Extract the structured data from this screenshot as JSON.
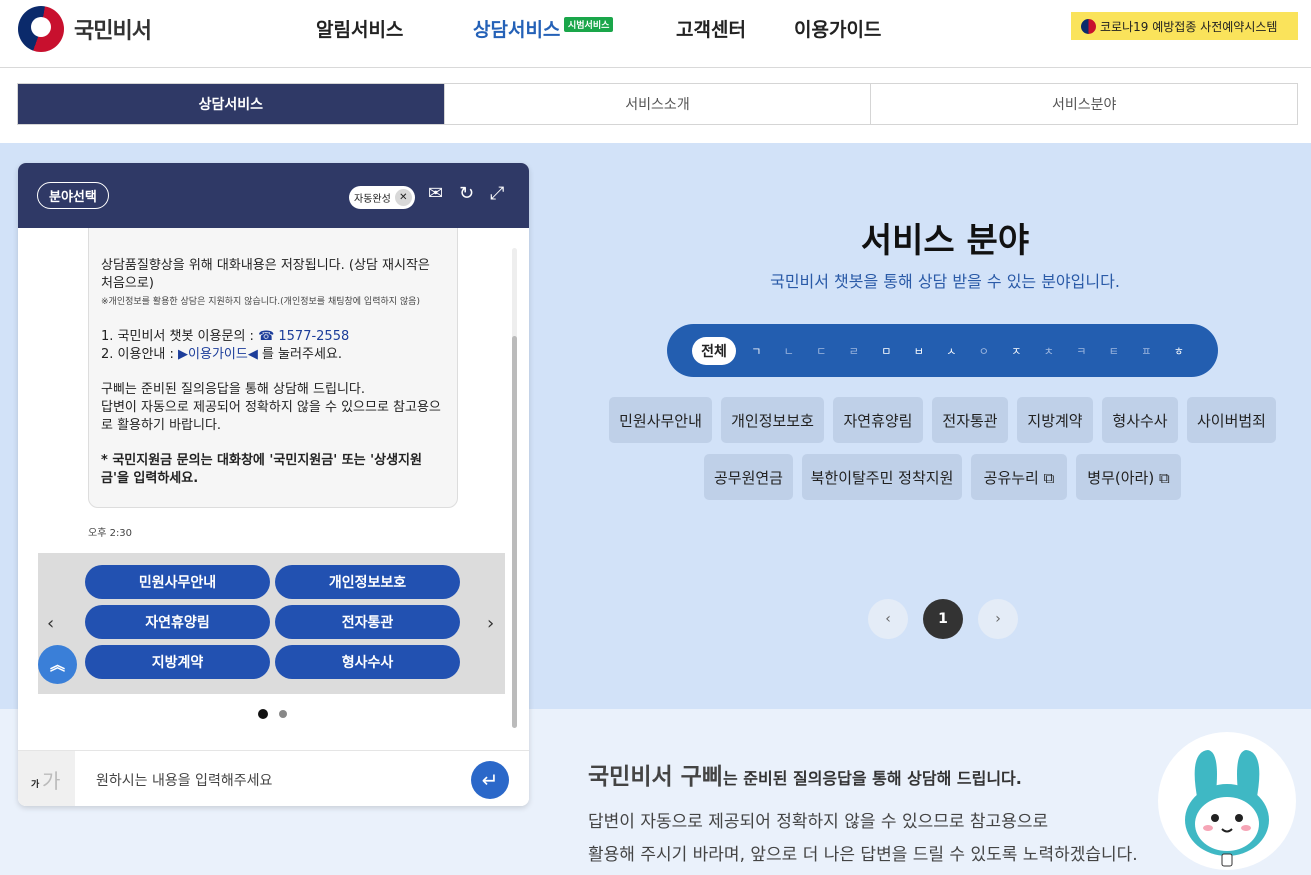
{
  "header": {
    "logo_text": "국민비서",
    "nav": [
      "알림서비스",
      "상담서비스",
      "고객센터",
      "이용가이드"
    ],
    "beta_badge": "시범서비스",
    "covid_banner": "코로나19 예방접종 사전예약시스템"
  },
  "tabs": [
    "상담서비스",
    "서비스소개",
    "서비스분야"
  ],
  "chat": {
    "field_select": "분야선택",
    "auto_complete": "자동완성",
    "message": {
      "line1": "상담품질향상을 위해 대화내용은 저장됩니다. (상담 재시작은 처음으로)",
      "note": "※개인정보를 활용한 상담은 지원하지 않습니다.(개인정보를 채팅창에 입력하지 않음)",
      "contact_prefix": "1. 국민비서 챗봇 이용문의 :",
      "contact_phone": "☎ 1577-2558",
      "guide_prefix": "2. 이용안내 :",
      "guide_link": "▶이용가이드◀",
      "guide_suffix": "를 눌러주세요.",
      "desc1": "구삐는 준비된 질의응답을 통해 상담해 드립니다.",
      "desc2": "답변이 자동으로 제공되어 정확하지 않을 수 있으므로 참고용으로 활용하기 바랍니다.",
      "notice": "* 국민지원금 문의는 대화창에 '국민지원금' 또는 '상생지원금'을 입력하세요."
    },
    "time": "오후 2:30",
    "quick_buttons": [
      "민원사무안내",
      "개인정보보호",
      "자연휴양림",
      "전자통관",
      "지방계약",
      "형사수사"
    ],
    "font_size_small": "가",
    "font_size_big": "가",
    "input_placeholder": "원하시는 내용을 입력해주세요"
  },
  "service": {
    "title": "서비스 분야",
    "subtitle": "국민비서 챗봇을 통해 상담 받을 수 있는 분야입니다.",
    "consonant_all": "전체",
    "consonants": [
      "ㄱ",
      "ㄴ",
      "ㄷ",
      "ㄹ",
      "ㅁ",
      "ㅂ",
      "ㅅ",
      "ㅇ",
      "ㅈ",
      "ㅊ",
      "ㅋ",
      "ㅌ",
      "ㅍ",
      "ㅎ"
    ],
    "tags_row1": [
      "민원사무안내",
      "개인정보보호",
      "자연휴양림",
      "전자통관",
      "지방계약",
      "형사수사",
      "사이버범죄"
    ],
    "tags_row2": [
      "공무원연금",
      "북한이탈주민 정착지원",
      "공유누리 ⧉",
      "병무(아라) ⧉"
    ],
    "pagination": {
      "prev": "‹",
      "current": "1",
      "next": "›"
    }
  },
  "intro": {
    "title_big": "국민비서 구삐",
    "title_rest": "는 준비된 질의응답을 통해 상담해 드립니다.",
    "line1": "답변이 자동으로 제공되어 정확하지 않을 수 있으므로 참고용으로",
    "line2": "활용해 주시기 바라며, 앞으로 더 나은 답변을 드릴 수 있도록 노력하겠습니다."
  }
}
